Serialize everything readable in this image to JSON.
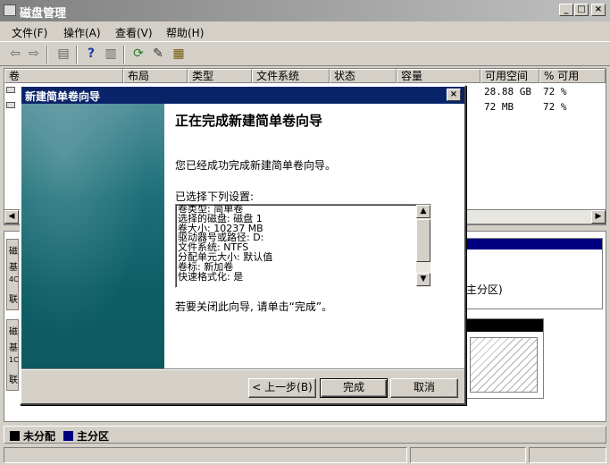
{
  "window": {
    "title": "磁盘管理"
  },
  "caption_buttons": {
    "minimize": "_",
    "maximize": "□",
    "close": "×"
  },
  "menu": [
    "文件(F)",
    "操作(A)",
    "查看(V)",
    "帮助(H)"
  ],
  "toolbar": {
    "icons": [
      "back-icon",
      "forward-icon",
      "console-tree-icon",
      "help-icon",
      "action-pane-icon",
      "refresh-icon",
      "properties-icon",
      "export-icon"
    ]
  },
  "volume_list": {
    "columns": [
      "卷",
      "布局",
      "类型",
      "文件系统",
      "状态",
      "容量",
      "可用空间",
      "% 可用"
    ],
    "rows": [
      {
        "free": "28.88 GB",
        "pct": "72 %"
      },
      {
        "free": "72 MB",
        "pct": "72 %"
      }
    ]
  },
  "disk_pane": {
    "left_fragments": [
      "磁",
      "基",
      "4C",
      "联",
      "磁",
      "基",
      "1C",
      "联"
    ],
    "partition_text": "主分区)"
  },
  "legend": {
    "unallocated": "未分配",
    "primary": "主分区",
    "unallocated_color": "#000000",
    "primary_color": "#000080"
  },
  "wizard": {
    "title": "新建简单卷向导",
    "heading": "正在完成新建简单卷向导",
    "success": "您已经成功完成新建简单卷向导。",
    "selected_label": "已选择下列设置:",
    "settings": [
      "卷类型: 简单卷",
      "选择的磁盘: 磁盘 1",
      "卷大小: 10237 MB",
      "驱动器号或路径: D:",
      "文件系统: NTFS",
      "分配单元大小: 默认值",
      "卷标: 新加卷",
      "快速格式化: 是"
    ],
    "close_hint": "若要关闭此向导, 请单击“完成”。",
    "buttons": {
      "back": "< 上一步(B)",
      "finish": "完成",
      "cancel": "取消"
    }
  }
}
